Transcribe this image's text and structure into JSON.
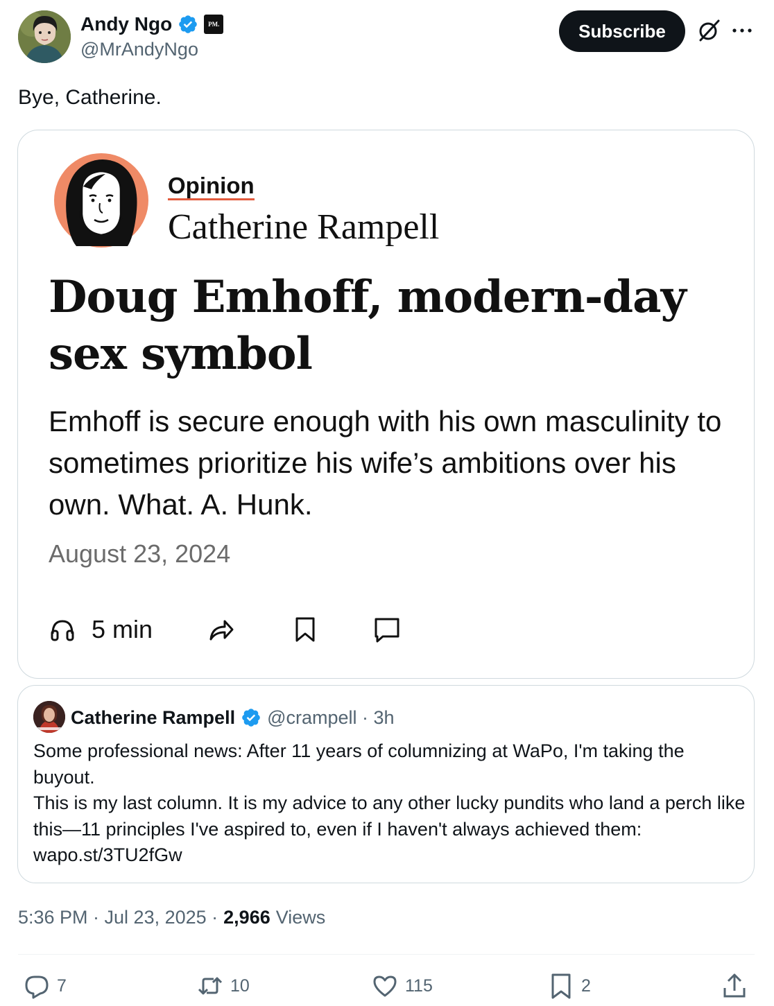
{
  "author": {
    "display_name": "Andy Ngo",
    "handle": "@MrAndyNgo",
    "affiliate_badge": "PM."
  },
  "header": {
    "subscribe_label": "Subscribe"
  },
  "tweet": {
    "text": "Bye, Catherine."
  },
  "article_card": {
    "section": "Opinion",
    "columnist": "Catherine Rampell",
    "headline": "Doug Emhoff, modern-day sex symbol",
    "dek": "Emhoff is secure enough with his own masculinity to sometimes prioritize his wife’s ambitions over his own. What. A. Hunk.",
    "date": "August 23, 2024",
    "listen_label": "5 min"
  },
  "quoted_tweet": {
    "display_name": "Catherine Rampell",
    "handle_time": "@crampell · 3h",
    "body": "Some professional news: After 11 years of columnizing at WaPo, I'm taking the buyout.\nThis is my last column. It is my advice to any other lucky pundits who land a perch like this—11 principles I've aspired to, even if I haven't always achieved them: wapo.st/3TU2fGw"
  },
  "meta": {
    "time_date": "5:36 PM · Jul 23, 2025 ·",
    "views_count": "2,966",
    "views_label": "Views"
  },
  "actions": {
    "replies": "7",
    "reposts": "10",
    "likes": "115",
    "bookmarks": "2"
  },
  "colors": {
    "verified_blue": "#1d9bf0",
    "text_primary": "#0f1419",
    "text_secondary": "#536471",
    "border": "#cfd9de",
    "opinion_accent": "#e25a3d",
    "author_circle": "#ef8a66"
  }
}
